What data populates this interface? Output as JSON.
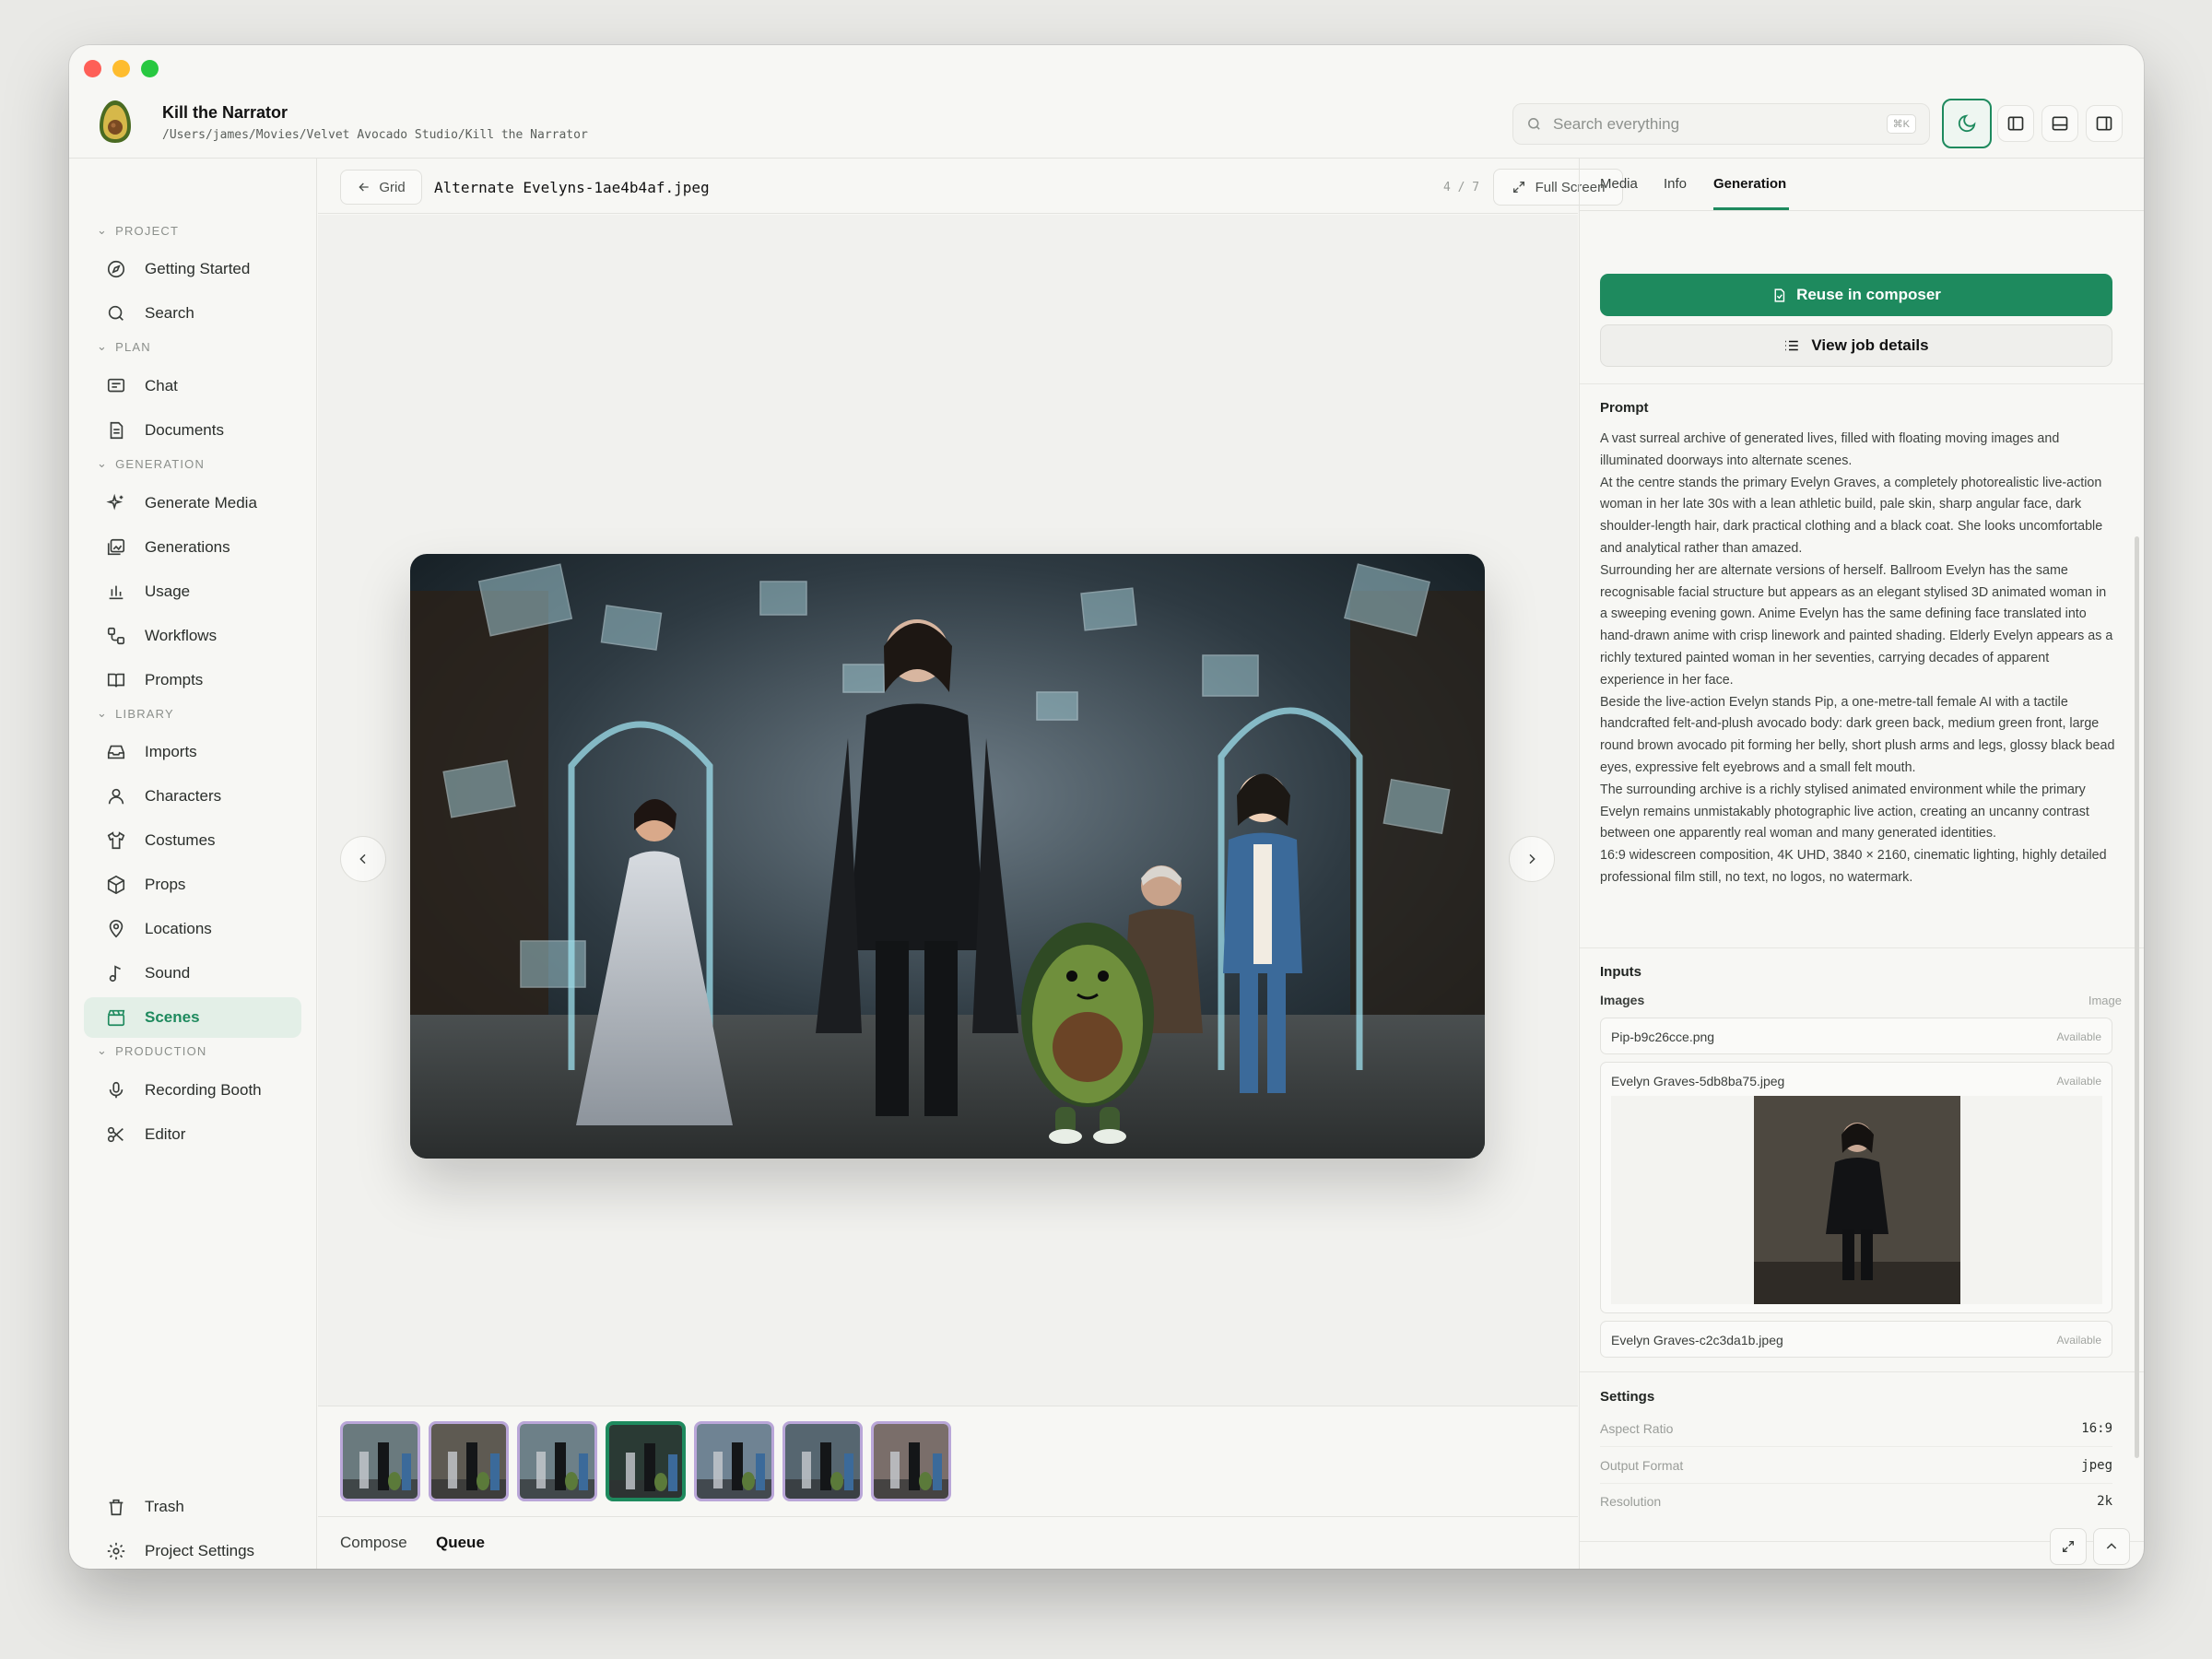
{
  "header": {
    "project_title": "Kill the Narrator",
    "project_path": "/Users/james/Movies/Velvet Avocado Studio/Kill the Narrator",
    "search_placeholder": "Search everything",
    "search_shortcut": "⌘K"
  },
  "sidebar": {
    "sections": {
      "project": "PROJECT",
      "plan": "PLAN",
      "generation": "GENERATION",
      "library": "LIBRARY",
      "production": "PRODUCTION"
    },
    "items": {
      "getting_started": "Getting Started",
      "search": "Search",
      "chat": "Chat",
      "documents": "Documents",
      "generate_media": "Generate Media",
      "generations": "Generations",
      "usage": "Usage",
      "workflows": "Workflows",
      "prompts": "Prompts",
      "imports": "Imports",
      "characters": "Characters",
      "costumes": "Costumes",
      "props": "Props",
      "locations": "Locations",
      "sound": "Sound",
      "scenes": "Scenes",
      "recording_booth": "Recording Booth",
      "editor": "Editor",
      "trash": "Trash",
      "project_settings": "Project Settings"
    },
    "active_item": "Scenes"
  },
  "viewer": {
    "grid_label": "Grid",
    "filename": "Alternate Evelyns-1ae4b4af.jpeg",
    "counter": "4 / 7",
    "fullscreen_label": "Full Screen",
    "thumbnail_count": 7,
    "active_thumbnail": 4
  },
  "bottom_tabs": {
    "compose": "Compose",
    "queue": "Queue",
    "active": "Queue"
  },
  "right_panel": {
    "tabs": {
      "media": "Media",
      "info": "Info",
      "generation": "Generation"
    },
    "active_tab": "Generation",
    "reuse_label": "Reuse in composer",
    "job_label": "View job details",
    "prompt_heading": "Prompt",
    "prompt_paragraphs": [
      "A vast surreal archive of generated lives, filled with floating moving images and illuminated doorways into alternate scenes.",
      "At the centre stands the primary Evelyn Graves, a completely photorealistic live-action woman in her late 30s with a lean athletic build, pale skin, sharp angular face, dark shoulder-length hair, dark practical clothing and a black coat. She looks uncomfortable and analytical rather than amazed.",
      "Surrounding her are alternate versions of herself. Ballroom Evelyn has the same recognisable facial structure but appears as an elegant stylised 3D animated woman in a sweeping evening gown. Anime Evelyn has the same defining face translated into hand-drawn anime with crisp linework and painted shading. Elderly Evelyn appears as a richly textured painted woman in her seventies, carrying decades of apparent experience in her face.",
      "Beside the live-action Evelyn stands Pip, a one-metre-tall female AI with a tactile handcrafted felt-and-plush avocado body: dark green back, medium green front, large round brown avocado pit forming her belly, short plush arms and legs, glossy black bead eyes, expressive felt eyebrows and a small felt mouth.",
      "The surrounding archive is a richly stylised animated environment while the primary Evelyn remains unmistakably photographic live action, creating an uncanny contrast between one apparently real woman and many generated identities.",
      "16:9 widescreen composition, 4K UHD, 3840 × 2160, cinematic lighting, highly detailed professional film still, no text, no logos, no watermark."
    ],
    "inputs_heading": "Inputs",
    "images_label": "Images",
    "images_type": "Image",
    "input_images": [
      {
        "name": "Pip-b9c26cce.png",
        "status": "Available"
      },
      {
        "name": "Evelyn Graves-5db8ba75.jpeg",
        "status": "Available"
      },
      {
        "name": "Evelyn Graves-c2c3da1b.jpeg",
        "status": "Available"
      }
    ],
    "settings_heading": "Settings",
    "settings": {
      "aspect_ratio": {
        "label": "Aspect Ratio",
        "value": "16:9"
      },
      "output_format": {
        "label": "Output Format",
        "value": "jpeg"
      },
      "resolution": {
        "label": "Resolution",
        "value": "2k"
      }
    },
    "colors": {
      "accent": "#1e8a5e",
      "thumb_border": "#b9a6d8"
    }
  }
}
